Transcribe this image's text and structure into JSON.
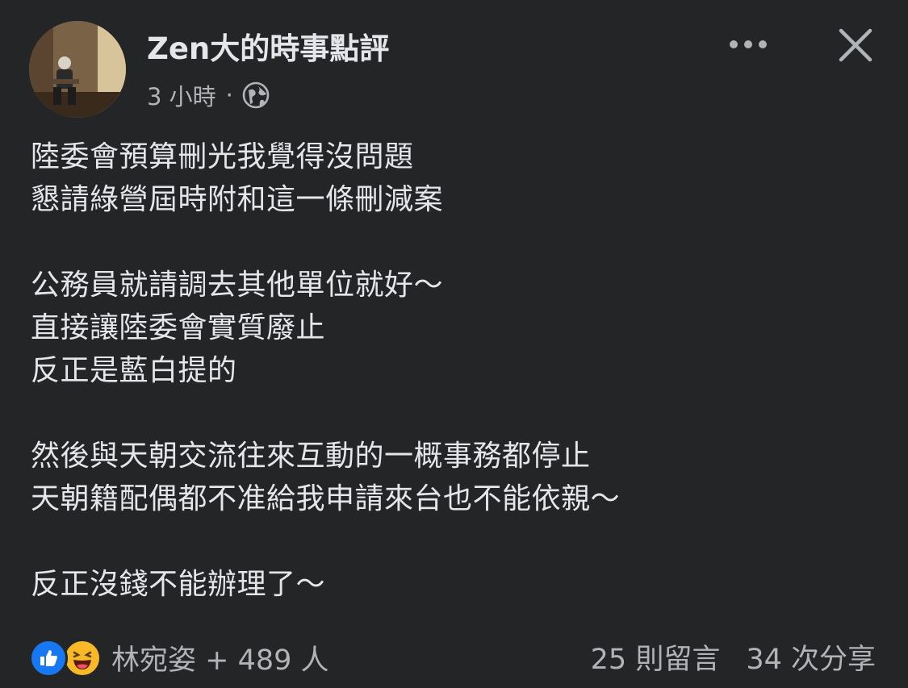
{
  "post": {
    "author": "Zen大的時事點評",
    "time": "3 小時",
    "separator": "·",
    "privacy_icon": "globe-icon",
    "paragraphs": [
      [
        "陸委會預算刪光我覺得沒問題",
        "懇請綠營屆時附和這一條刪減案"
      ],
      [
        "公務員就請調去其他單位就好～",
        "直接讓陸委會實質廢止",
        "反正是藍白提的"
      ],
      [
        "然後與天朝交流往來互動的一概事務都停止",
        "天朝籍配偶都不准給我申請來台也不能依親～"
      ],
      [
        "反正沒錢不能辦理了～"
      ]
    ]
  },
  "actions": {
    "more_icon": "more-dots-icon",
    "close_icon": "close-icon"
  },
  "footer": {
    "reaction_icons": [
      "like-icon",
      "haha-icon"
    ],
    "reactions_text": "林宛姿 + 489 人",
    "comments": "25 則留言",
    "shares": "34 次分享"
  },
  "colors": {
    "background": "#242526",
    "primary_text": "#e4e6eb",
    "secondary_text": "#b0b3b8",
    "like_blue": "#1877f2",
    "haha_yellow": "#f7b928"
  }
}
